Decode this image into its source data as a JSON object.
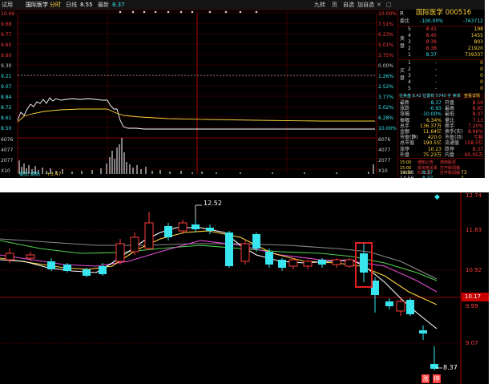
{
  "header": {
    "tabs": "试用",
    "stock_name": "国际医学",
    "mode": "分时",
    "period": "日线",
    "avg_text": "8.55",
    "last_label": "最新",
    "last_text": "8.37",
    "right_items": [
      "九转",
      "页",
      "自选",
      "加自选"
    ],
    "ctrl_icons": [
      "close-icon",
      "maximize-icon",
      "arrow-left-icon",
      "arrow-right-icon"
    ]
  },
  "chart": {
    "left_axis": [
      "10.69",
      "9.68",
      "9.77",
      "9.65",
      "9.60",
      "9.51",
      "9.42",
      "9.30",
      "9.21",
      "9.07",
      "8.84",
      "8.72",
      "8.61",
      "8.50",
      "8.37"
    ],
    "right_axis": [
      "10.00%",
      "8.62%",
      "7.51%",
      "6.23%",
      "5.01%",
      "3.75%",
      "2.50%",
      "1.25%",
      "0.00%",
      "1.26%",
      "2.52%",
      "3.77%",
      "5.02%",
      "6.28%",
      "10.00%"
    ],
    "vol_left": [
      "6076",
      "6076",
      "4077",
      "4077",
      "2077",
      "2077",
      "X10"
    ],
    "vol_right": [
      "6076",
      "6076",
      "4077",
      "4077",
      "2077",
      "2077",
      "X10"
    ],
    "bottom_axis": [
      "09:30",
      "10:30",
      "13:00",
      "14:00",
      "15:00"
    ],
    "bottom_info": "委比 跳贴",
    "bottom_info2": "+3.47"
  },
  "quote": {
    "title": "国际医学 000516",
    "r": "R",
    "weibi_label": "委比",
    "weibi": "-100.00%",
    "weicha": "-763712",
    "sell": [
      {
        "lv": "5",
        "p": "8.41",
        "v": "198"
      },
      {
        "lv": "4",
        "p": "8.40",
        "v": "1455"
      },
      {
        "lv": "3",
        "p": "8.39",
        "v": "803"
      },
      {
        "lv": "2",
        "p": "8.38",
        "v": "21920"
      },
      {
        "lv": "1",
        "p": "8.37",
        "v": "739337"
      }
    ],
    "sell_side": "卖盘",
    "buy": [
      {
        "lv": "1",
        "p": "-",
        "v": "0"
      },
      {
        "lv": "2",
        "p": "-",
        "v": "0"
      },
      {
        "lv": "3",
        "p": "-",
        "v": "0"
      },
      {
        "lv": "4",
        "p": "-",
        "v": "0"
      },
      {
        "lv": "5",
        "p": "-",
        "v": "0"
      }
    ],
    "buy_side": "买盘",
    "tabs": "在卖盘 8.42 位置有 5740 手 卖单",
    "tabs_right": "查看详情",
    "stats": [
      {
        "l": "最新",
        "v": "8.37",
        "l2": "开盘",
        "v2": "8.59"
      },
      {
        "l": "涨跌",
        "v": "-0.93",
        "l2": "最高",
        "v2": "8.95"
      },
      {
        "l": "涨幅",
        "v": "-10.00%",
        "l2": "最低",
        "v2": "8.37"
      },
      {
        "l": "振幅",
        "v": "6.34%",
        "l2": "量比",
        "v2": "7.13"
      },
      {
        "l": "总手",
        "v": "136.37万",
        "l2": "换手",
        "v2": "7.20%"
      },
      {
        "l": "金额",
        "v": "11.64亿",
        "l2": "换手(实)",
        "v2": "8.96%"
      },
      {
        "l": "市盈(静)",
        "v": "420.0",
        "l2": "市盈(动)",
        "v2": "亏损"
      },
      {
        "l": "总市值",
        "v": "190.5亿",
        "l2": "流通值",
        "v2": "158.5亿"
      },
      {
        "l": "涨停",
        "v": "10.23",
        "l2": "跌停",
        "v2": "8.37"
      },
      {
        "l": "外盘",
        "v": "75.23万",
        "l2": "内盘",
        "v2": "60.05万"
      }
    ],
    "news": [
      {
        "t": "15:00",
        "s": "通知公告",
        "d": "增持股票"
      },
      {
        "t": "15:00",
        "s": "投资者关系",
        "d": "打开新闻稿"
      },
      {
        "t": "15:00",
        "s": "H2公告",
        "d": "打开新闻稿"
      }
    ],
    "ticks": [
      {
        "t": "14:56",
        "p": "8.37",
        "v": "73"
      },
      {
        "t": "14:56",
        "p": "8.37",
        "v": "2"
      }
    ]
  },
  "kline": {
    "price_left": [
      "12.52",
      "8.37"
    ],
    "axis_right": [
      "12.74",
      "11.83",
      "10.92",
      "10.17",
      "9.99",
      "9.07"
    ],
    "badges": [
      "涨",
      "停"
    ],
    "colors": {
      "up": "#ff3b3b",
      "down": "#39e6ef",
      "ma5": "#ffffff",
      "ma10": "#ffd23c",
      "ma20": "#e24fd9",
      "ma30": "#4fd04f",
      "ma60": "#8a8a8a",
      "highlight": "#e02020",
      "current": "#c80000"
    }
  }
}
